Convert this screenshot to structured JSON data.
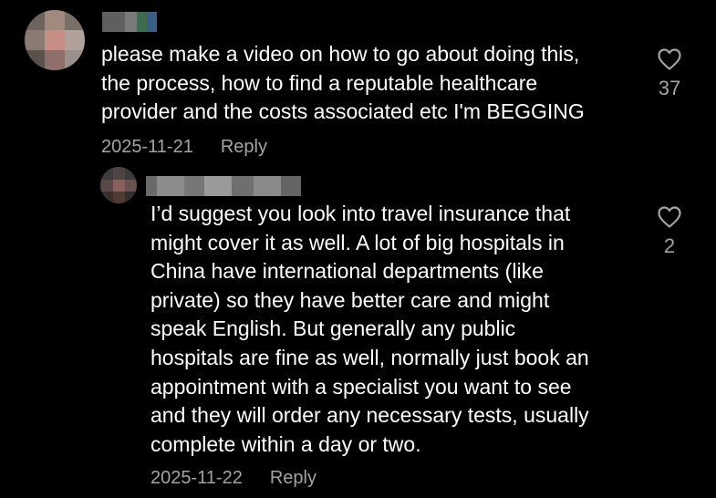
{
  "comments": [
    {
      "text": "please make a video on how to go about doing this,\nthe process, how to find a reputable healthcare\nprovider and the costs associated etc I'm BEGGING",
      "date": "2025-11-21",
      "reply_label": "Reply",
      "like_icon": "heart-outline-icon",
      "likes": "37"
    },
    {
      "text": "I’d suggest you look into travel insurance that\nmight cover it as well. A lot of big hospitals in\nChina have international departments (like\nprivate) so they have better care and might\nspeak English. But generally any public\nhospitals are fine as well, normally just book an\nappointment with a specialist you want to see\nand they will order any necessary tests, usually\ncomplete within a day or two.",
      "date": "2025-11-22",
      "reply_label": "Reply",
      "like_icon": "heart-outline-icon",
      "likes": "2"
    }
  ],
  "colors": {
    "background": "#000000",
    "text": "#ffffff",
    "secondary_text": "#a3a3a3"
  }
}
